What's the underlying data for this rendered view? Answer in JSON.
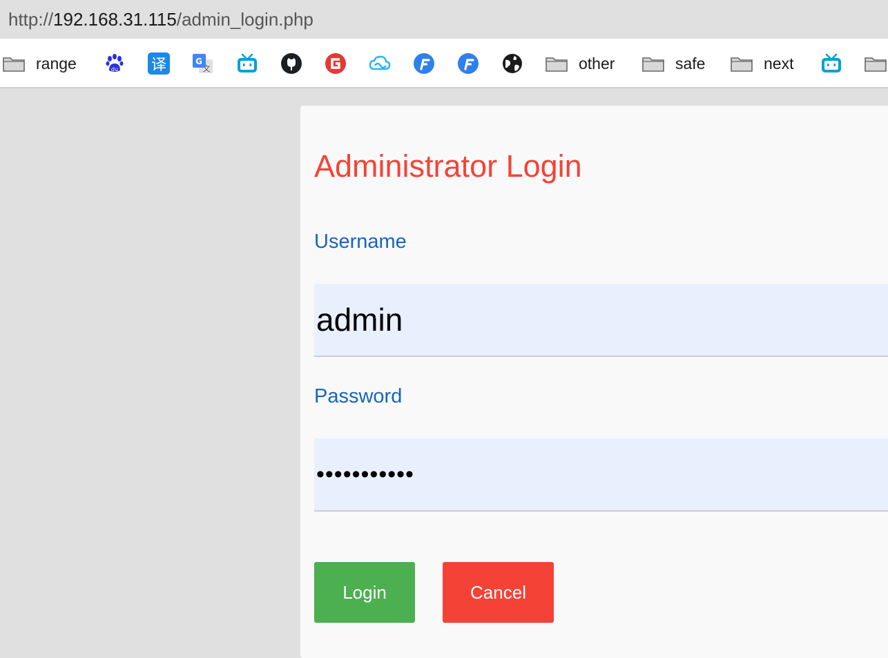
{
  "address_bar": {
    "scheme": "http://",
    "host": "192.168.31.115",
    "path": "/admin_login.php"
  },
  "bookmarks": [
    {
      "type": "folder",
      "label": "range"
    },
    {
      "type": "icon",
      "icon": "baidu-icon"
    },
    {
      "type": "icon",
      "icon": "translate-icon",
      "glyph": "译"
    },
    {
      "type": "icon",
      "icon": "google-translate-icon"
    },
    {
      "type": "icon",
      "icon": "bilibili-icon"
    },
    {
      "type": "icon",
      "icon": "github-icon"
    },
    {
      "type": "icon",
      "icon": "g-red-icon"
    },
    {
      "type": "icon",
      "icon": "cloud-icon"
    },
    {
      "type": "icon",
      "icon": "f-blue-icon"
    },
    {
      "type": "icon",
      "icon": "f-blue-icon"
    },
    {
      "type": "icon",
      "icon": "globe-icon"
    },
    {
      "type": "folder",
      "label": "other"
    },
    {
      "type": "folder",
      "label": "safe"
    },
    {
      "type": "folder",
      "label": "next"
    },
    {
      "type": "icon",
      "icon": "bilibili-icon"
    },
    {
      "type": "folder",
      "label": ""
    }
  ],
  "login": {
    "title": "Administrator Login",
    "username_label": "Username",
    "username_value": "admin",
    "password_label": "Password",
    "password_value": "•••••••••••",
    "login_button": "Login",
    "cancel_button": "Cancel"
  },
  "colors": {
    "title": "#f44336",
    "label": "#1565c0",
    "input_bg": "#e8f0fe",
    "login_btn": "#4caf50",
    "cancel_btn": "#f44336"
  }
}
